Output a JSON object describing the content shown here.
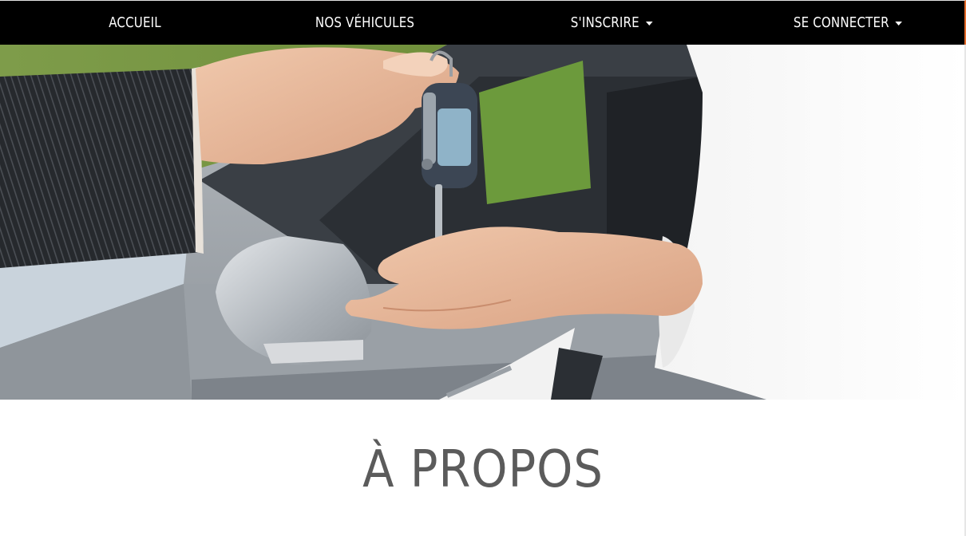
{
  "navbar": {
    "items": [
      {
        "label": "ACCUEIL",
        "dropdown": false
      },
      {
        "label": "NOS VÉHICULES",
        "dropdown": false
      },
      {
        "label": "S'INSCRIRE",
        "dropdown": true
      },
      {
        "label": "SE CONNECTER",
        "dropdown": true
      }
    ]
  },
  "hero": {
    "image": "car-key-handover-photo"
  },
  "section": {
    "title": "À PROPOS"
  },
  "colors": {
    "navbar_bg": "#000000",
    "navbar_text": "#ffffff",
    "title_text": "#5b5b5b",
    "accent_edge": "#e46a2a"
  }
}
